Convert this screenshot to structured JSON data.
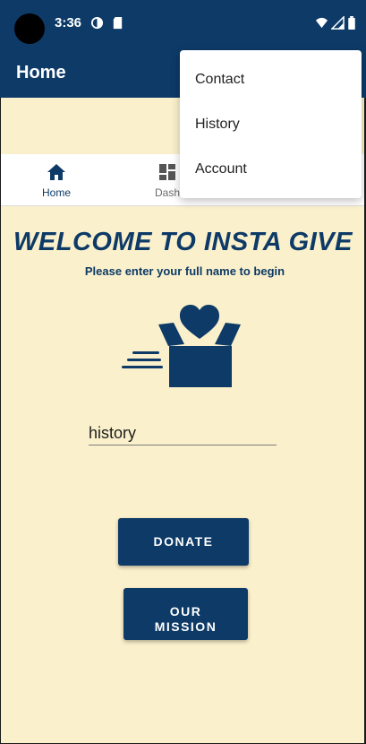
{
  "status_bar": {
    "time": "3:36",
    "icons": [
      "camera-cutout-icon",
      "sync-icon",
      "sd-card-icon",
      "wifi-icon",
      "signal-icon",
      "battery-icon"
    ]
  },
  "app_bar": {
    "title": "Home"
  },
  "tabs": [
    {
      "label": "Home",
      "icon": "home-icon",
      "active": true
    },
    {
      "label": "Dash",
      "icon": "dashboard-icon",
      "active": false
    }
  ],
  "overflow_menu": {
    "items": [
      "Contact",
      "History",
      "Account"
    ]
  },
  "main": {
    "welcome": "WELCOME TO INSTA GIVE",
    "subtitle": "Please enter your full name to begin",
    "name_input_value": "history",
    "donate_label": "DONATE",
    "mission_line1": "OUR",
    "mission_line2": "MISSION"
  },
  "colors": {
    "primary": "#0d3a67",
    "background": "#faf0cb",
    "surface": "#ffffff"
  }
}
